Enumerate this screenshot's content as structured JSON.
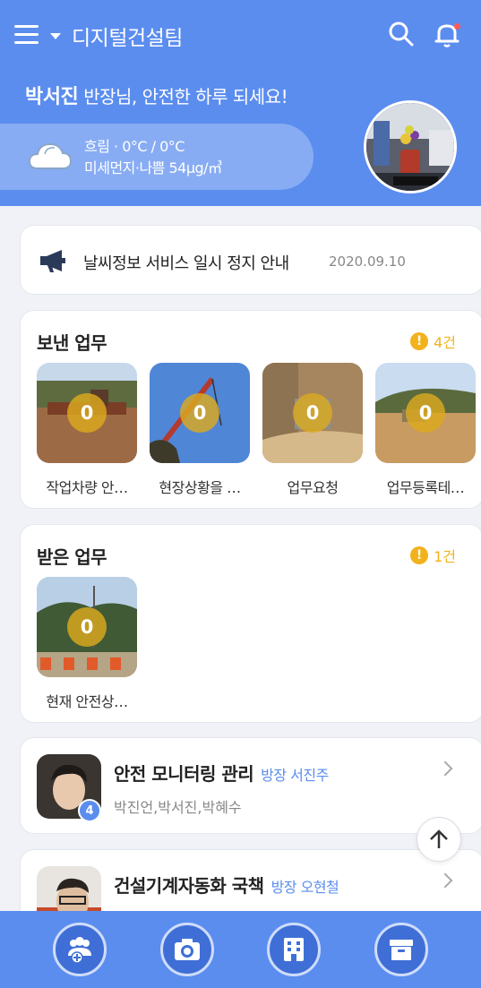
{
  "header": {
    "team_name": "디지털건설팀",
    "user_name": "박서진",
    "greeting": "반장님, 안전한 하루 되세요!",
    "weather_line1": "흐림 · 0°C / 0°C",
    "weather_line2": "미세먼지·나쁨 54μg/㎥",
    "notification_dot_color": "#ff5a5a"
  },
  "notice": {
    "message": "날씨정보 서비스 일시 정지 안내",
    "date": "2020.09.10"
  },
  "sent_tasks": {
    "title": "보낸 업무",
    "count": "4건",
    "items": [
      {
        "label": "작업차량 안…",
        "badge": "0"
      },
      {
        "label": "현장상황을 …",
        "badge": "0"
      },
      {
        "label": "업무요청",
        "badge": "0"
      },
      {
        "label": "업무등록테…",
        "badge": "0"
      }
    ]
  },
  "received_tasks": {
    "title": "받은 업무",
    "count": "1건",
    "items": [
      {
        "label": "현재 안전상…",
        "badge": "0"
      }
    ]
  },
  "projects": [
    {
      "name": "안전 모니터링 관리",
      "leader": "방장 서진주",
      "members": "박진언,박서진,박혜수",
      "count": "4"
    },
    {
      "name": "건설기계자동화 국책",
      "leader": "방장 오현철",
      "members": "",
      "count": ""
    }
  ],
  "colors": {
    "primary": "#5b8def",
    "warning": "#f2b21c"
  },
  "bottom_nav": [
    "add-group-icon",
    "camera-icon",
    "building-icon",
    "archive-icon"
  ]
}
